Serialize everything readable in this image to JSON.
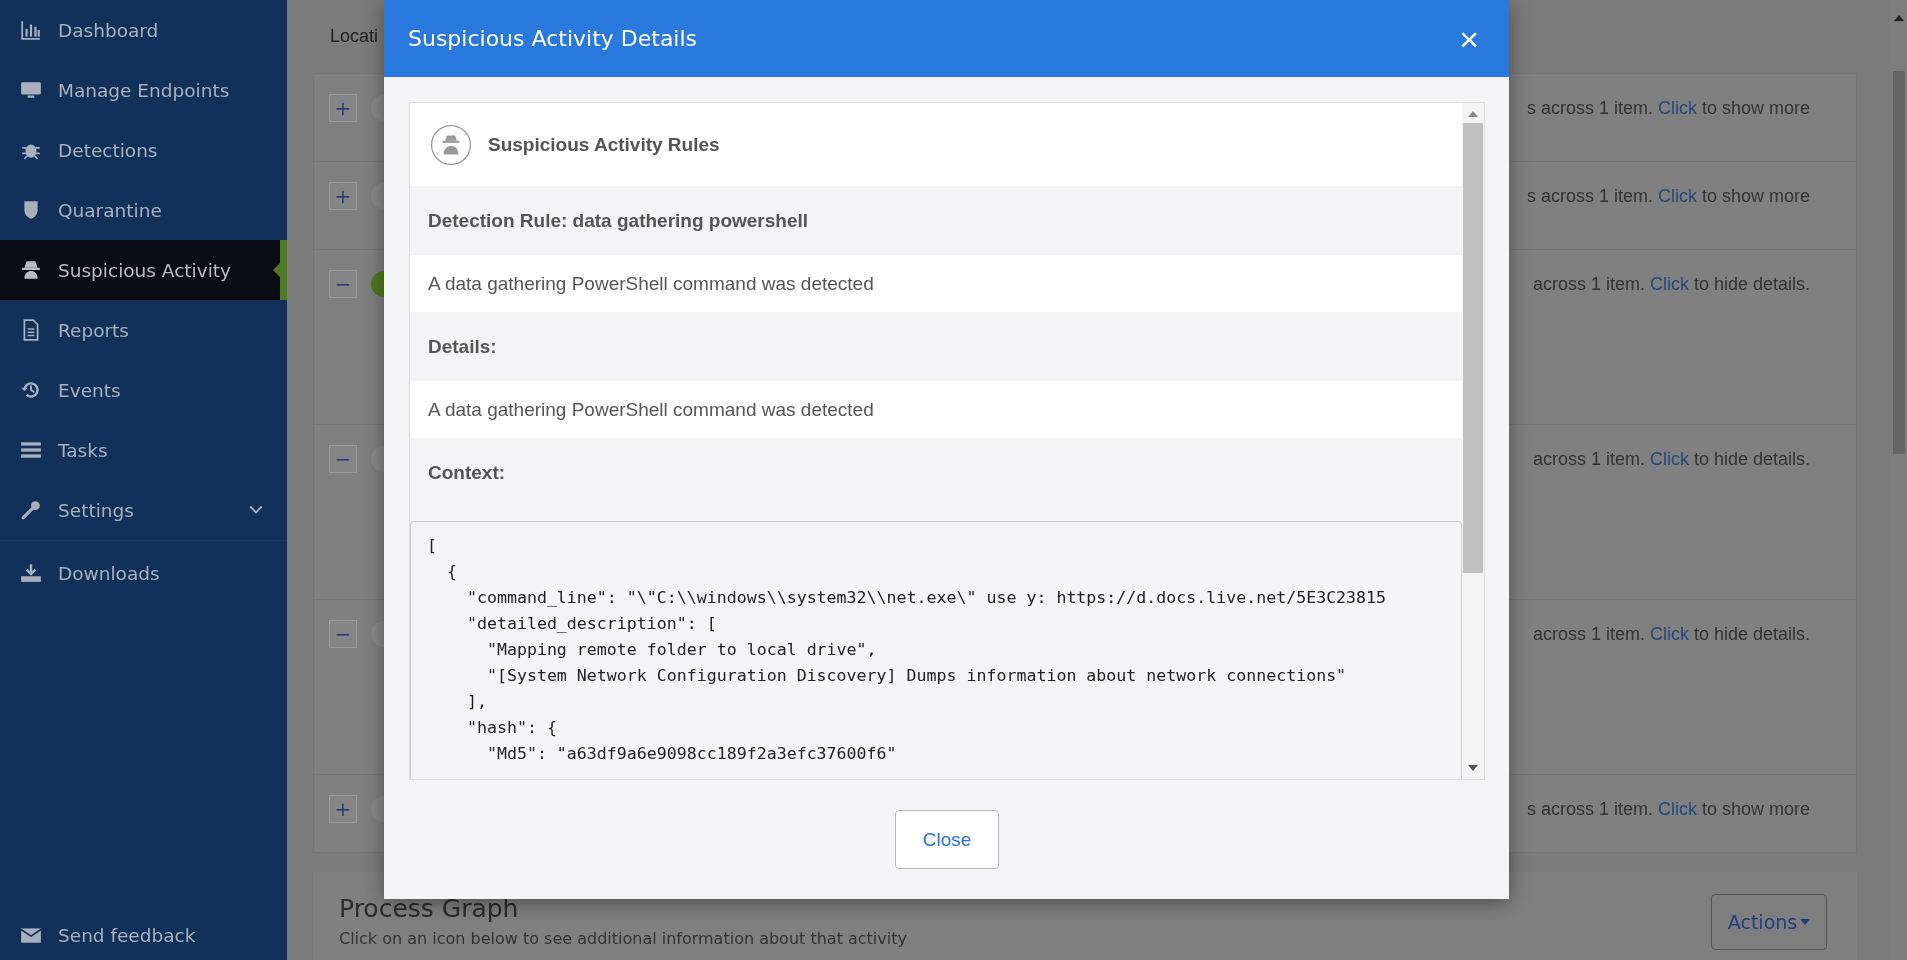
{
  "sidebar": {
    "items": [
      {
        "label": "Dashboard",
        "selected": false,
        "kind": "link"
      },
      {
        "label": "Manage Endpoints",
        "selected": false,
        "kind": "link"
      },
      {
        "label": "Detections",
        "selected": false,
        "kind": "link"
      },
      {
        "label": "Quarantine",
        "selected": false,
        "kind": "link"
      },
      {
        "label": "Suspicious Activity",
        "selected": true,
        "kind": "link"
      },
      {
        "label": "Reports",
        "selected": false,
        "kind": "link"
      },
      {
        "label": "Events",
        "selected": false,
        "kind": "link"
      },
      {
        "label": "Tasks",
        "selected": false,
        "kind": "link"
      },
      {
        "label": "Settings",
        "selected": false,
        "kind": "menu"
      },
      {
        "label": "Downloads",
        "selected": false,
        "kind": "link"
      }
    ],
    "feedback": "Send feedback"
  },
  "page": {
    "header": "Locati",
    "rows": [
      {
        "toggle": "+",
        "expanded": false,
        "color": "#8a8a8a",
        "summary": "s across 1 item.",
        "link": "Click",
        "action": "to show more"
      },
      {
        "toggle": "+",
        "expanded": false,
        "color": "#8a8a8a",
        "summary": "s across 1 item.",
        "link": "Click",
        "action": "to show more"
      },
      {
        "toggle": "−",
        "expanded": true,
        "color": "#4e7a22",
        "summary": "across 1 item.",
        "link": "Click",
        "action": "to hide details."
      },
      {
        "toggle": "−",
        "expanded": true,
        "color": "#8a8a8a",
        "summary": "across 1 item.",
        "link": "Click",
        "action": "to hide details."
      },
      {
        "toggle": "−",
        "expanded": true,
        "color": "#8a8a8a",
        "summary": "across 1 item.",
        "link": "Click",
        "action": "to hide details."
      },
      {
        "toggle": "+",
        "expanded": false,
        "color": "#8a8a8a",
        "summary": "s across 1 item.",
        "link": "Click",
        "action": "to show more"
      }
    ],
    "process_graph": {
      "title": "Process Graph",
      "subtitle": "Click on an icon below to see additional information about that activity",
      "actions": "Actions"
    }
  },
  "modal": {
    "title": "Suspicious Activity Details",
    "close_glyph": "×",
    "panel_title": "Suspicious Activity Rules",
    "sections": [
      {
        "kind": "heading",
        "text": "Detection Rule: data gathering powershell"
      },
      {
        "kind": "text",
        "text": "A data gathering PowerShell command was detected"
      },
      {
        "kind": "heading",
        "text": "Details:"
      },
      {
        "kind": "text",
        "text": "A data gathering PowerShell command was detected"
      },
      {
        "kind": "heading",
        "text": "Context:"
      }
    ],
    "code_lines": [
      "[",
      "  {",
      "    \"command_line\": \"\\\"C:\\\\windows\\\\system32\\\\net.exe\\\" use y: https://d.docs.live.net/5E3C23815",
      "    \"detailed_description\": [",
      "      \"Mapping remote folder to local drive\",",
      "      \"[System Network Configuration Discovery] Dumps information about network connections\"",
      "    ],",
      "    \"hash\": {",
      "      \"Md5\": \"a63df9a6e9098cc189f2a3efc37600f6\""
    ],
    "button": "Close"
  }
}
